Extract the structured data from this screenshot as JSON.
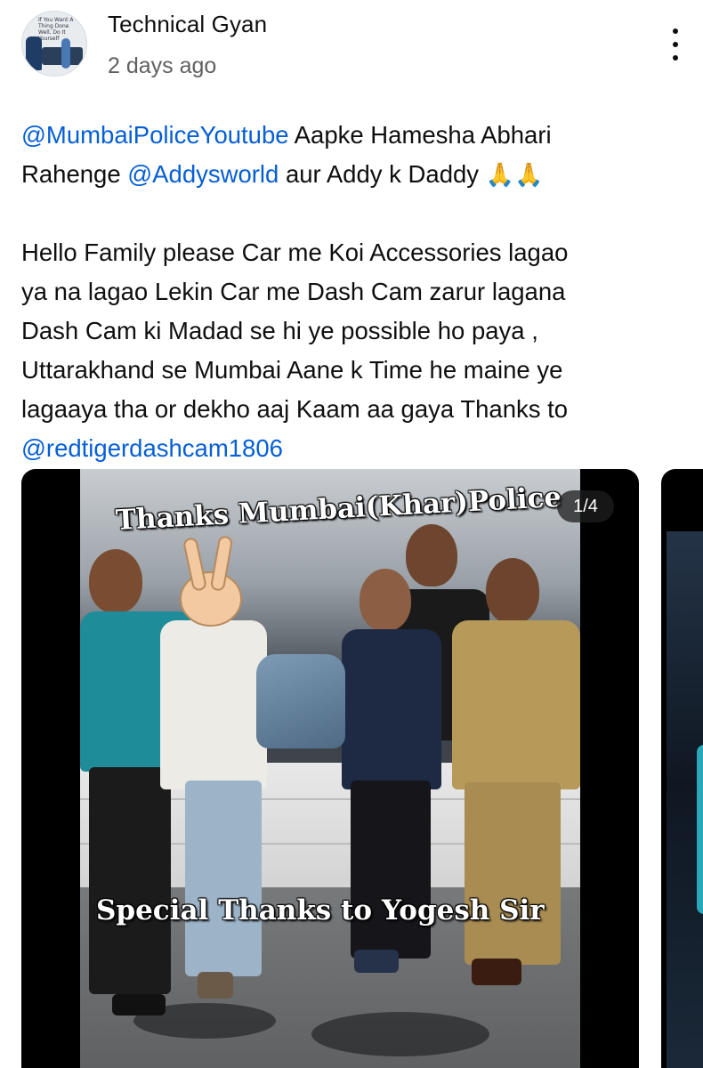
{
  "post": {
    "channel_name": "Technical Gyan",
    "timestamp": "2 days ago",
    "menu_icon": "more-vertical-icon",
    "avatar_text": "If You Want A Thing Done Well, Do It Yourself",
    "lines": [
      [
        "@MumbaiPoliceYoutube",
        " Aapke Hamesha Abhari"
      ],
      [
        "Rahenge ",
        "@Addysworld",
        " aur Addy k Daddy ",
        "🙏🙏"
      ],
      [
        "Hello Family please Car me Koi Accessories lagao"
      ],
      [
        "ya na lagao Lekin Car me Dash Cam zarur lagana"
      ],
      [
        "Dash Cam ki Madad se hi ye possible ho paya ,"
      ],
      [
        "Uttarakhand se Mumbai Aane k Time he maine ye"
      ],
      [
        "lagaaya tha or dekho aaj Kaam aa gaya Thanks to"
      ],
      [
        "@redtigerdashcam1806"
      ]
    ],
    "text": {
      "l1_mention": "@MumbaiPoliceYoutube",
      "l1_rest": " Aapke Hamesha Abhari",
      "l2_start": "Rahenge ",
      "l2_mention": "@Addysworld",
      "l2_rest": " aur Addy k Daddy ",
      "l2_emoji": "🙏🙏",
      "l3": "Hello Family please Car me Koi Accessories lagao",
      "l4": "ya na lagao Lekin Car me Dash Cam zarur lagana",
      "l5": "Dash Cam ki Madad se hi ye possible ho paya ,",
      "l6": "Uttarakhand se Mumbai Aane k Time he maine ye",
      "l7": "lagaaya tha or dekho aaj Kaam aa gaya Thanks to",
      "l8_mention": "@redtigerdashcam1806"
    }
  },
  "carousel": {
    "page_counter": "1/4",
    "image": {
      "overlay_title": "Thanks Mumbai(Khar)Police",
      "overlay_bottom": "Special Thanks to Yogesh Sir",
      "emoji_icon": "victory-hand-icon"
    }
  },
  "colors": {
    "mention": "#065fd4",
    "text": "#0f0f0f",
    "secondary": "#606060",
    "card_bg": "#000000"
  }
}
